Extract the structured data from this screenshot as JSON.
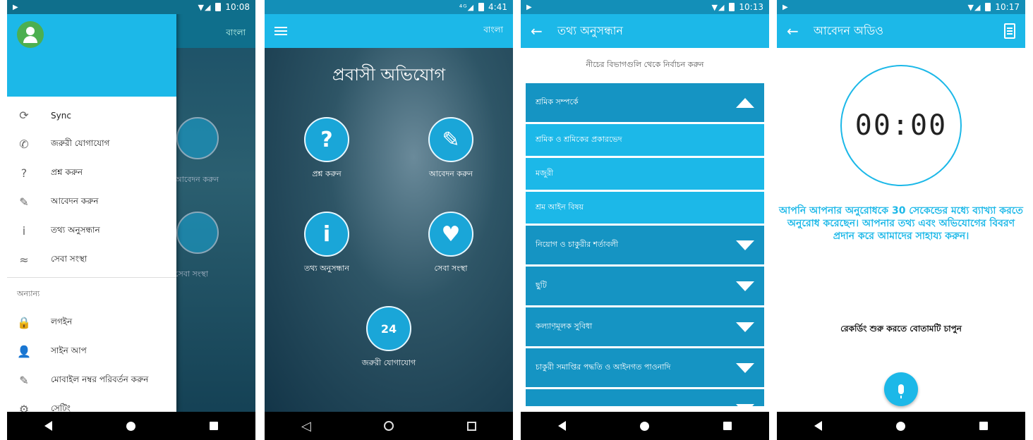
{
  "screen1": {
    "status": {
      "time": "10:08"
    },
    "bg_lang": "বাংলা",
    "bg_labels": [
      "আবেদন করুন",
      "সেবা সংস্থা"
    ],
    "menu": [
      {
        "icon": "sync-icon",
        "glyph": "⟳",
        "label": "Sync"
      },
      {
        "icon": "phone-icon",
        "glyph": "✆",
        "label": "জরুরী যোগাযোগ"
      },
      {
        "icon": "question-icon",
        "glyph": "?",
        "label": "প্রশ্ন করুন"
      },
      {
        "icon": "edit-icon",
        "glyph": "✎",
        "label": "আবেদন করুন"
      },
      {
        "icon": "info-icon",
        "glyph": "i",
        "label": "তথ্য অনুসন্ধান"
      },
      {
        "icon": "handshake-icon",
        "glyph": "≈",
        "label": "সেবা সংস্থা"
      }
    ],
    "section_label": "অন্যান্য",
    "menu2": [
      {
        "icon": "lock-icon",
        "glyph": "🔒",
        "label": "লগইন"
      },
      {
        "icon": "add-user-icon",
        "glyph": "👤",
        "label": "সাইন আপ"
      },
      {
        "icon": "edit-icon",
        "glyph": "✎",
        "label": "মোবাইল নম্বর পরিবর্তন করুন"
      },
      {
        "icon": "gear-icon",
        "glyph": "⚙",
        "label": "সেটিং"
      }
    ]
  },
  "screen2": {
    "status": {
      "time": "4:41"
    },
    "lang": "বাংলা",
    "hero_title": "প্রবাসী অভিযোগ",
    "tiles": [
      {
        "glyph": "?",
        "label": "প্রশ্ন করুন"
      },
      {
        "glyph": "✎",
        "label": "আবেদন করুন"
      },
      {
        "glyph": "i",
        "label": "তথ্য অনুসন্ধান"
      },
      {
        "glyph": "♥",
        "label": "সেবা সংস্থা"
      },
      {
        "glyph": "24",
        "label": "জরুরী যোগাযোগ"
      }
    ]
  },
  "screen3": {
    "status": {
      "time": "10:13"
    },
    "title": "তথ্য অনুসন্ধান",
    "hint": "নীচের বিভাগগুলি থেকে নির্বাচন করুন",
    "rows": [
      {
        "type": "header",
        "label": "শ্রমিক সম্পর্কে",
        "arrow": "up"
      },
      {
        "type": "sub",
        "label": "শ্রমিক ও শ্রমিকের প্রকারভেদ"
      },
      {
        "type": "sub",
        "label": "মজুরী"
      },
      {
        "type": "sub",
        "label": "শ্রম আইন বিষয়"
      },
      {
        "type": "header",
        "label": "নিয়োগ ও চাকুরীর শর্তাবলী",
        "arrow": "down"
      },
      {
        "type": "header",
        "label": "ছুটি",
        "arrow": "down"
      },
      {
        "type": "header",
        "label": "কল্যা়ণমূলক সুবিধা",
        "arrow": "down"
      },
      {
        "type": "header",
        "label": "চাকুরী সমাপ্তির পদ্ধতি ও আইনগত পাওনাদি",
        "arrow": "down"
      },
      {
        "type": "header",
        "label": "",
        "arrow": "down"
      }
    ]
  },
  "screen4": {
    "status": {
      "time": "10:17"
    },
    "title": "আবেদন অডিও",
    "timer": "00:00",
    "instruction": "আপনি আপনার অনুরোধকে 30 সেকেন্ডের মধ্যে ব্যাখ্যা করতে অনুরোধ করেছেন। আপনার তথ্য এবং অভিযোগের বিবরণ প্রদান করে আমাদের সাহায্য করুন।",
    "press_hint": "রেকর্ডিং শুরু করতে বোতামটি চাপুন"
  },
  "colors": {
    "accent": "#1cb8e8",
    "header_row": "#1594c3",
    "avatar": "#4caf50"
  }
}
